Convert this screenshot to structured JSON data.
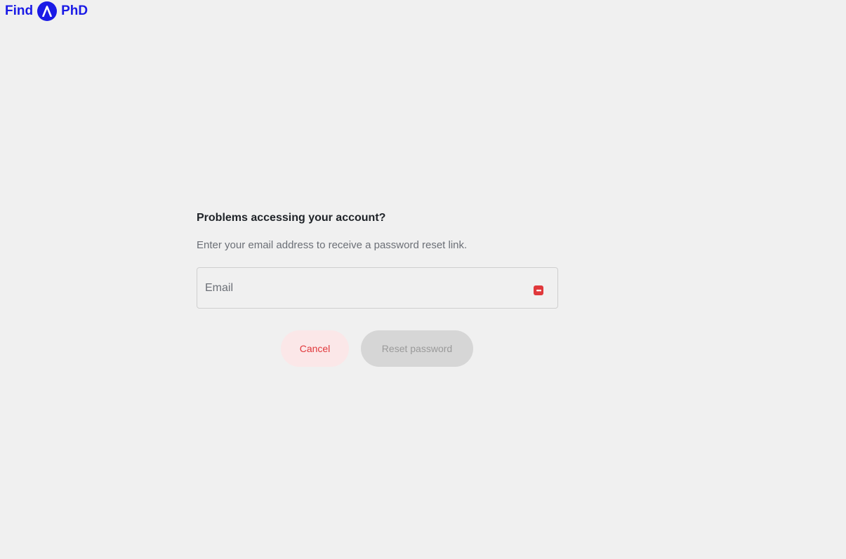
{
  "brand": {
    "left_text": "Find",
    "right_text": "PhD",
    "color": "#1a1ae6"
  },
  "reset_form": {
    "heading": "Problems accessing your account?",
    "description": "Enter your email address to receive a password reset link.",
    "email": {
      "placeholder": "Email",
      "value": ""
    },
    "password_manager_icon": "password-manager-icon",
    "cancel_label": "Cancel",
    "submit_label": "Reset password"
  },
  "colors": {
    "background": "#f0f0f0",
    "accent_red": "#e0383b",
    "disabled_button": "#d6d6d6"
  }
}
